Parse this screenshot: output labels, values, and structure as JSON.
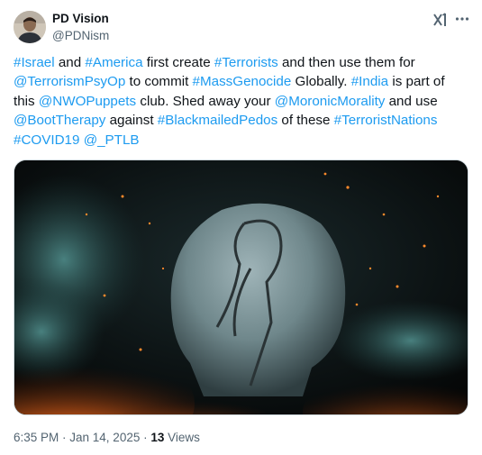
{
  "author": {
    "display_name": "PD Vision",
    "handle": "@PDNism"
  },
  "icons": {
    "grok": "grok-icon",
    "more": "more-icon"
  },
  "tweet": {
    "segments": [
      {
        "text": "#Israel",
        "link": true
      },
      {
        "text": " and ",
        "link": false
      },
      {
        "text": "#America",
        "link": true
      },
      {
        "text": " first create ",
        "link": false
      },
      {
        "text": "#Terrorists",
        "link": true
      },
      {
        "text": " and then use them for ",
        "link": false
      },
      {
        "text": "@TerrorismPsyOp",
        "link": true
      },
      {
        "text": " to commit ",
        "link": false
      },
      {
        "text": "#MassGenocide",
        "link": true
      },
      {
        "text": " Globally. ",
        "link": false
      },
      {
        "text": "#India",
        "link": true
      },
      {
        "text": " is part of this ",
        "link": false
      },
      {
        "text": "@NWOPuppets",
        "link": true
      },
      {
        "text": " club. Shed away your ",
        "link": false
      },
      {
        "text": "@MoronicMorality",
        "link": true
      },
      {
        "text": " and use ",
        "link": false
      },
      {
        "text": "@BootTherapy",
        "link": true
      },
      {
        "text": " against ",
        "link": false
      },
      {
        "text": "#BlackmailedPedos",
        "link": true
      },
      {
        "text": " of these ",
        "link": false
      },
      {
        "text": "#TerroristNations",
        "link": true
      },
      {
        "text": " ",
        "link": false
      },
      {
        "text": "#COVID19",
        "link": true
      },
      {
        "text": " ",
        "link": false
      },
      {
        "text": "@_PTLB",
        "link": true
      }
    ]
  },
  "meta": {
    "timestamp": "6:35 PM · Jan 14, 2025 · ",
    "views_count": "13",
    "views_label": " Views"
  },
  "colors": {
    "link": "#1d9bf0",
    "text": "#0f1419",
    "muted": "#536471"
  }
}
